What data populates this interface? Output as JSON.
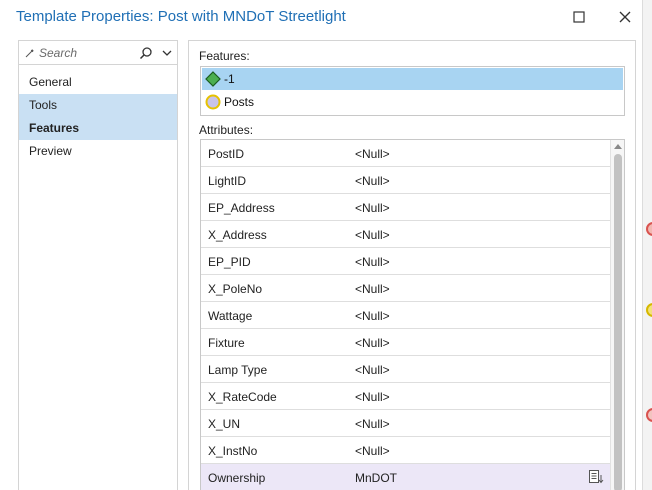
{
  "window": {
    "title": "Template Properties: Post with MNDoT Streetlight",
    "maximize_icon": "maximize-icon",
    "close_icon": "close-icon"
  },
  "search": {
    "placeholder": "Search"
  },
  "nav": {
    "items": [
      {
        "label": "General",
        "selected": false
      },
      {
        "label": "Tools",
        "selected": true
      },
      {
        "label": "Features",
        "selected": true
      },
      {
        "label": "Preview",
        "selected": false
      }
    ]
  },
  "features": {
    "label": "Features:",
    "items": [
      {
        "label": "-1",
        "icon": "green-diamond-icon",
        "selected": true
      },
      {
        "label": "Posts",
        "icon": "yellow-circle-icon",
        "selected": false
      }
    ]
  },
  "attributes": {
    "label": "Attributes:",
    "rows": [
      {
        "name": "PostID",
        "value": "<Null>"
      },
      {
        "name": "LightID",
        "value": "<Null>"
      },
      {
        "name": "EP_Address",
        "value": "<Null>"
      },
      {
        "name": "X_Address",
        "value": "<Null>"
      },
      {
        "name": "EP_PID",
        "value": "<Null>"
      },
      {
        "name": "X_PoleNo",
        "value": "<Null>"
      },
      {
        "name": "Wattage",
        "value": "<Null>"
      },
      {
        "name": "Fixture",
        "value": "<Null>"
      },
      {
        "name": "Lamp Type",
        "value": "<Null>"
      },
      {
        "name": "X_RateCode",
        "value": "<Null>"
      },
      {
        "name": "X_UN",
        "value": "<Null>"
      },
      {
        "name": "X_InstNo",
        "value": "<Null>"
      },
      {
        "name": "Ownership",
        "value": "MnDOT"
      }
    ]
  },
  "colors": {
    "title": "#1f6fb5",
    "nav_selected": "#c9e0f3",
    "feature_selected": "#a8d4f2",
    "row_highlight": "#ece7f7"
  }
}
